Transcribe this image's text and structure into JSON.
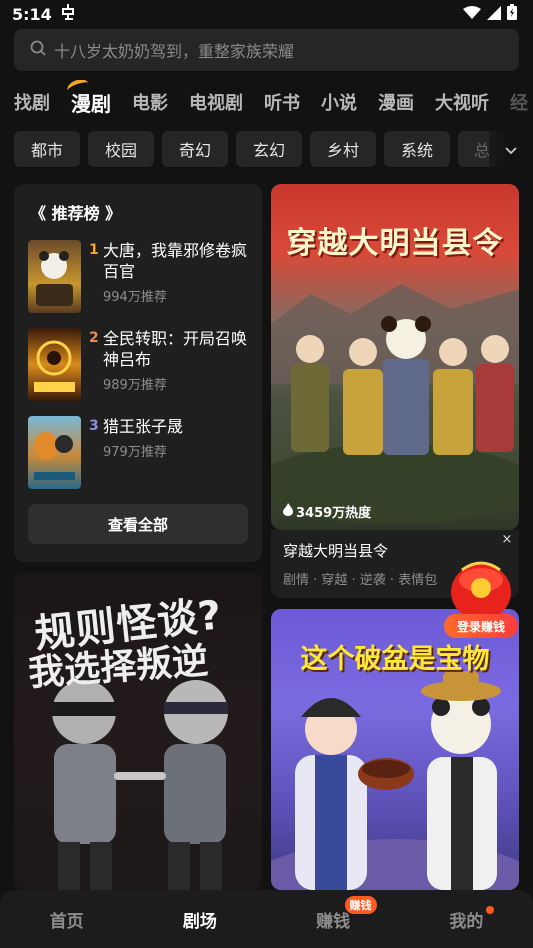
{
  "status_bar": {
    "time": "5:14"
  },
  "search": {
    "placeholder": "十八岁太奶奶驾到，重整家族荣耀"
  },
  "category_tabs": [
    {
      "label": "找剧"
    },
    {
      "label": "漫剧"
    },
    {
      "label": "电影"
    },
    {
      "label": "电视剧"
    },
    {
      "label": "听书"
    },
    {
      "label": "小说"
    },
    {
      "label": "漫画"
    },
    {
      "label": "大视听"
    },
    {
      "label": "经"
    }
  ],
  "active_tab": "漫剧",
  "genre_chips": [
    {
      "label": "都市"
    },
    {
      "label": "校园"
    },
    {
      "label": "奇幻"
    },
    {
      "label": "玄幻"
    },
    {
      "label": "乡村"
    },
    {
      "label": "系统"
    },
    {
      "label": "总"
    }
  ],
  "ranking": {
    "title": "《 推荐榜 》",
    "items": [
      {
        "rank": "1",
        "name": "大唐，我靠邪修卷疯百官",
        "hot": "994万推荐",
        "rank_color": "#f5a623"
      },
      {
        "rank": "2",
        "name": "全民转职：开局召唤神吕布",
        "hot": "989万推荐",
        "rank_color": "#f08c4a"
      },
      {
        "rank": "3",
        "name": "猎王张子晟",
        "hot": "979万推荐",
        "rank_color": "#8f8fd8"
      }
    ],
    "view_all": "查看全部"
  },
  "posters": {
    "p1": {
      "title": "穿越大明当县令",
      "heat": "3459万热度",
      "name": "穿越大明当县令",
      "tags": "剧情 · 穿越 · 逆袭 · 表情包"
    },
    "p2": {
      "title_line1": "规则怪谈?",
      "title_line2": "我选择叛逆"
    },
    "p3": {
      "title": "这个破盆是宝物"
    }
  },
  "float_reward": {
    "label": "登录赚钱",
    "close": "×"
  },
  "bottom_nav": [
    {
      "label": "首页"
    },
    {
      "label": "剧场"
    },
    {
      "label": "赚钱",
      "badge": "赚钱"
    },
    {
      "label": "我的"
    }
  ],
  "colors": {
    "accent": "#f5a623",
    "badge": "#ff5a1f",
    "background": "#121212",
    "card": "#1f1f1f"
  }
}
